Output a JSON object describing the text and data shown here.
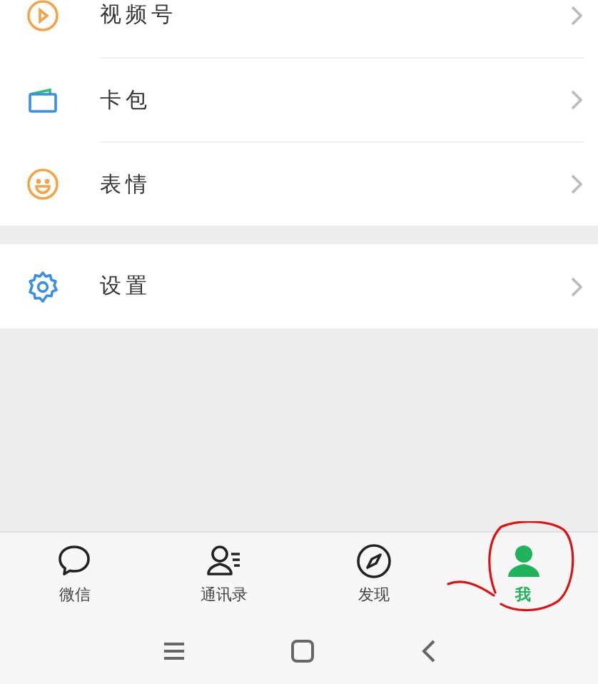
{
  "menu_groups": [
    {
      "items": [
        {
          "kind": "channels",
          "label": "视频号"
        },
        {
          "kind": "wallet",
          "label": "卡包"
        },
        {
          "kind": "sticker",
          "label": "表情"
        }
      ]
    },
    {
      "items": [
        {
          "kind": "settings",
          "label": "设置"
        }
      ]
    }
  ],
  "tabs": [
    {
      "kind": "chat",
      "label": "微信",
      "selected": false
    },
    {
      "kind": "contacts",
      "label": "通讯录",
      "selected": false
    },
    {
      "kind": "discover",
      "label": "发现",
      "selected": false
    },
    {
      "kind": "me",
      "label": "我",
      "selected": true
    }
  ],
  "nav_bar": [
    {
      "kind": "menu"
    },
    {
      "kind": "home"
    },
    {
      "kind": "back"
    }
  ]
}
